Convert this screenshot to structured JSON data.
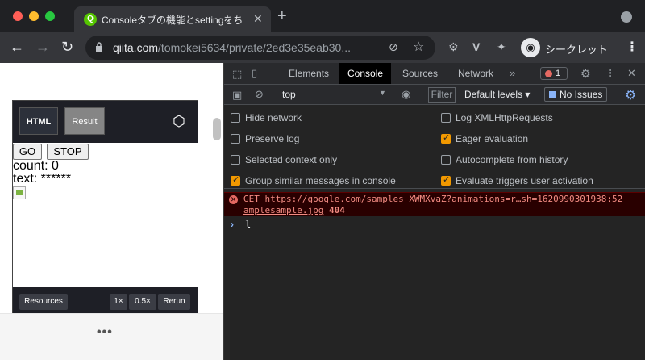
{
  "window": {
    "tab_title": "Consoleタブの機能とsettingをち",
    "url_host": "qiita.com",
    "url_path": "/tomokei5634/private/2ed3e35eab30...",
    "profile_label": "シークレット"
  },
  "codepen": {
    "tabs": [
      "HTML",
      "Result"
    ],
    "buttons": {
      "go": "GO",
      "stop": "STOP"
    },
    "count_line": "count: 0",
    "text_line": "text: ******",
    "footer": {
      "resources": "Resources",
      "zoom1": "1×",
      "zoom05": "0.5×",
      "rerun": "Rerun"
    }
  },
  "page": {
    "more_dots": "•••"
  },
  "devtools": {
    "tabs": [
      "Elements",
      "Console",
      "Sources",
      "Network"
    ],
    "more_tabs": "»",
    "active_tab": "Console",
    "error_count": "1",
    "context": "top",
    "filter_placeholder": "Filter",
    "levels": "Default levels ▾",
    "issues": "No Issues",
    "settings": [
      {
        "label": "Hide network",
        "checked": false
      },
      {
        "label": "Log XMLHttpRequests",
        "checked": false
      },
      {
        "label": "Preserve log",
        "checked": false
      },
      {
        "label": "Eager evaluation",
        "checked": true
      },
      {
        "label": "Selected context only",
        "checked": false
      },
      {
        "label": "Autocomplete from history",
        "checked": false
      },
      {
        "label": "Group similar messages in console",
        "checked": true
      },
      {
        "label": "Evaluate triggers user activation",
        "checked": true
      }
    ],
    "error": {
      "method": "GET",
      "url": "https://google.com/samples",
      "source": "XWMXvaZ?animations=r…sh=1620990301938:52",
      "file": "amplesample.jpg",
      "status": "404"
    },
    "console_input": "l"
  },
  "colors": {
    "checkbox_on": "#f29900",
    "error_bg": "#290000",
    "error_text": "#f28b82",
    "accent": "#8ab4f8"
  }
}
